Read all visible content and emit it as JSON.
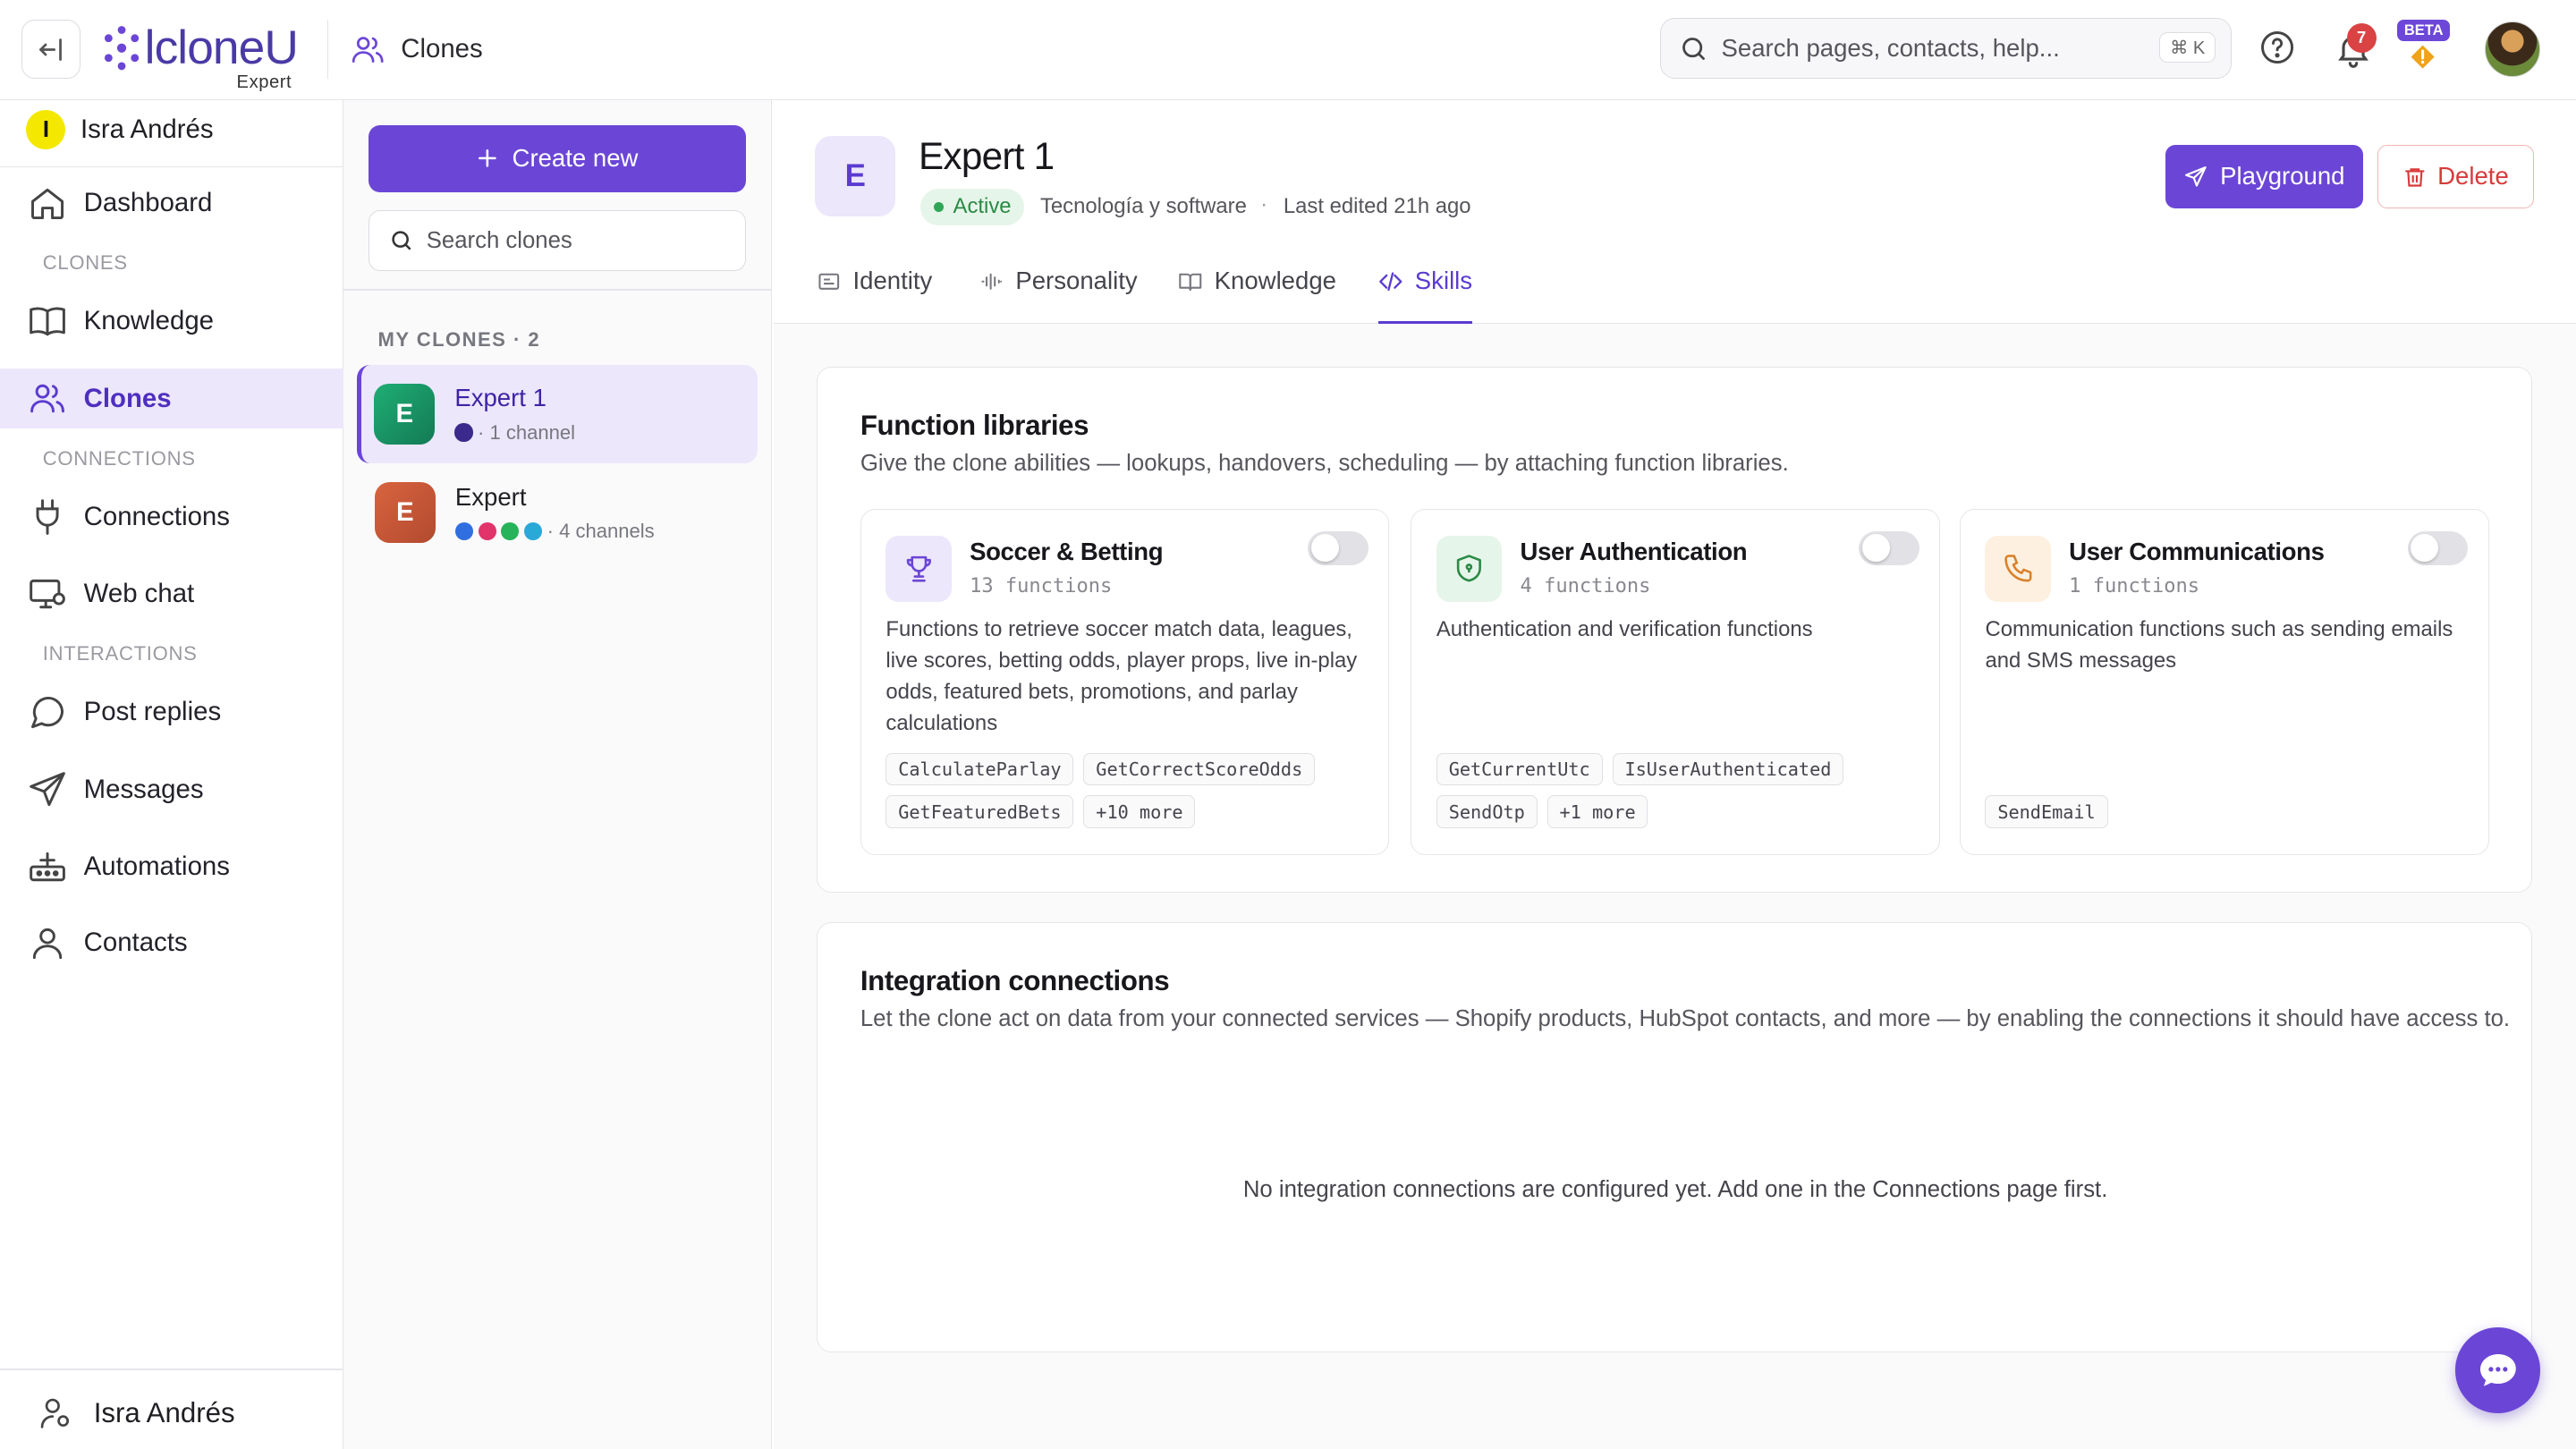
{
  "header": {
    "brand": "lcloneU",
    "brand_sub": "Expert",
    "breadcrumb": "Clones",
    "search_placeholder": "Search pages, contacts, help...",
    "search_shortcut": "⌘ K",
    "notification_count": "7",
    "beta_label": "BETA"
  },
  "sidebar": {
    "user_initial": "I",
    "user_name": "Isra Andrés",
    "items": [
      {
        "label": "Dashboard",
        "icon": "home-icon"
      },
      {
        "section": "CLONES"
      },
      {
        "label": "Knowledge",
        "icon": "book-icon"
      },
      {
        "label": "Clones",
        "icon": "users-icon",
        "active": true
      },
      {
        "section": "CONNECTIONS"
      },
      {
        "label": "Connections",
        "icon": "plug-icon"
      },
      {
        "label": "Web chat",
        "icon": "monitor-icon"
      },
      {
        "section": "INTERACTIONS"
      },
      {
        "label": "Post replies",
        "icon": "message-circle-icon"
      },
      {
        "label": "Messages",
        "icon": "send-icon"
      },
      {
        "label": "Automations",
        "icon": "automation-icon"
      },
      {
        "label": "Contacts",
        "icon": "user-icon"
      }
    ],
    "footer_user": "Isra Andrés"
  },
  "clones_panel": {
    "create_label": "Create new",
    "search_placeholder": "Search clones",
    "list_heading": "MY CLONES · 2",
    "clones": [
      {
        "initial": "E",
        "name": "Expert 1",
        "meta": "· 1 channel",
        "colors": [
          "#3b2a8c"
        ],
        "avatar_color": "#1a9a6a",
        "active": true
      },
      {
        "initial": "E",
        "name": "Expert",
        "meta": "· 4 channels",
        "colors": [
          "#2f6fe0",
          "#e0346a",
          "#27b35a",
          "#2aa8d8"
        ],
        "avatar_color": "#c8553a",
        "active": false
      }
    ]
  },
  "main": {
    "avatar_initial": "E",
    "title": "Expert 1",
    "status": "Active",
    "category": "Tecnología y software",
    "separator": "·",
    "last_edited": "Last edited 21h ago",
    "playground_label": "Playground",
    "delete_label": "Delete",
    "tabs": [
      {
        "label": "Identity",
        "icon": "id-card-icon"
      },
      {
        "label": "Personality",
        "icon": "waveform-icon"
      },
      {
        "label": "Knowledge",
        "icon": "book-open-icon"
      },
      {
        "label": "Skills",
        "icon": "code-icon",
        "active": true
      }
    ],
    "function_libraries": {
      "title": "Function libraries",
      "subtitle": "Give the clone abilities — lookups, handovers, scheduling — by attaching function libraries.",
      "libraries": [
        {
          "name": "Soccer & Betting",
          "count": "13 functions",
          "icon": "trophy-icon",
          "enabled": false,
          "description": "Functions to retrieve soccer match data, leagues, live scores, betting odds, player props, live in-play odds, featured bets, promotions, and parlay calculations",
          "functions": [
            "CalculateParlay",
            "GetCorrectScoreOdds",
            "GetFeaturedBets",
            "+10 more"
          ]
        },
        {
          "name": "User Authentication",
          "count": "4 functions",
          "icon": "shield-icon",
          "enabled": false,
          "description": "Authentication and verification functions",
          "functions": [
            "GetCurrentUtc",
            "IsUserAuthenticated",
            "SendOtp",
            "+1 more"
          ]
        },
        {
          "name": "User Communications",
          "count": "1 functions",
          "icon": "phone-icon",
          "enabled": false,
          "description": "Communication functions such as sending emails and SMS messages",
          "functions": [
            "SendEmail"
          ]
        }
      ]
    },
    "integrations": {
      "title": "Integration connections",
      "subtitle": "Let the clone act on data from your connected services — Shopify products, HubSpot contacts, and more — by enabling the connections it should have access to.",
      "empty_message": "No integration connections are configured yet. Add one in the Connections page first."
    }
  },
  "colors": {
    "accent": "#6b46d6",
    "active_bg": "#ece7fb",
    "danger": "#d83a3a",
    "success": "#2b8a45"
  }
}
